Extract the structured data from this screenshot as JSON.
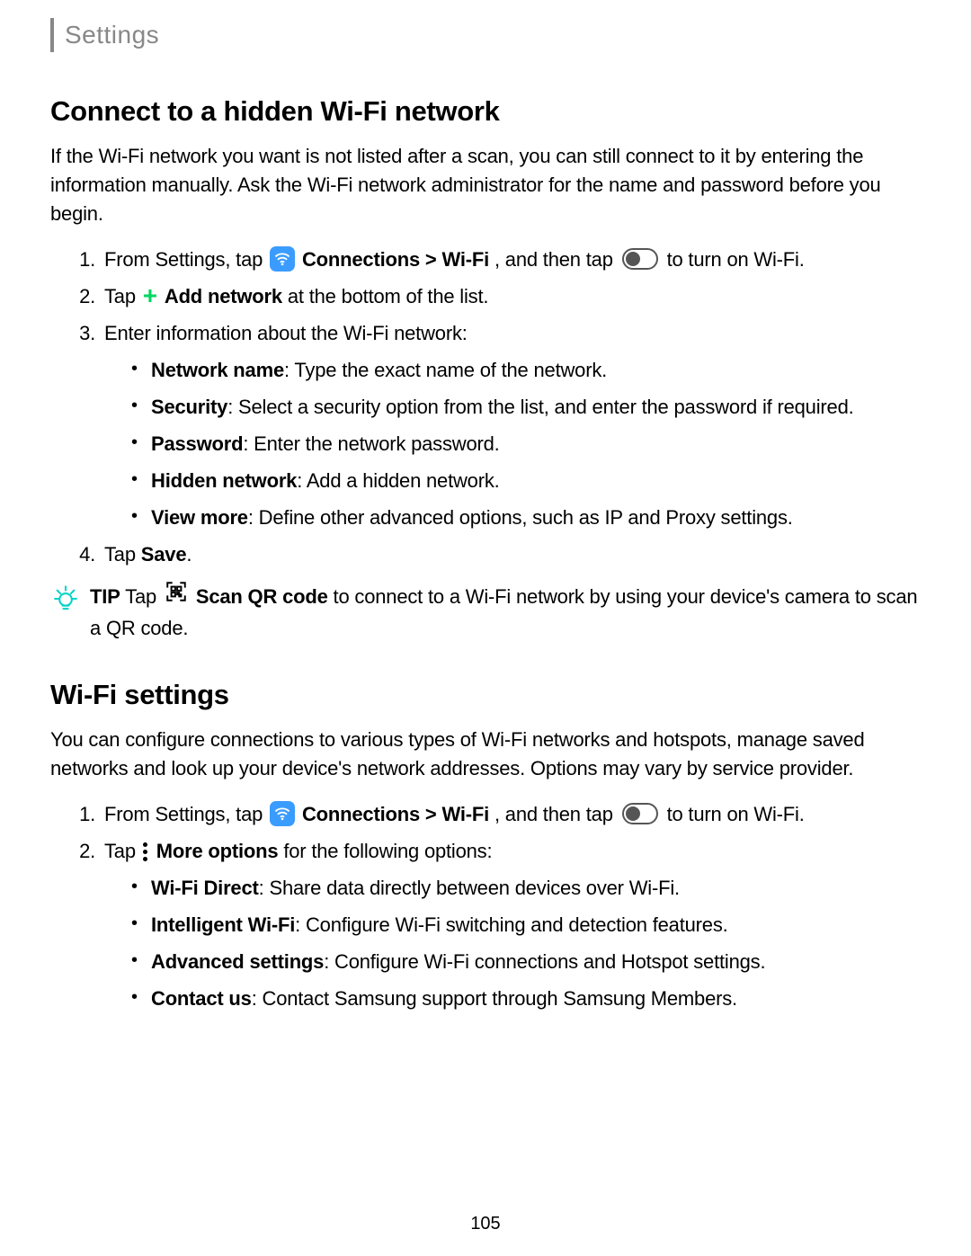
{
  "header": {
    "title": "Settings"
  },
  "section1": {
    "heading": "Connect to a hidden Wi-Fi network",
    "intro": "If the Wi-Fi network you want is not listed after a scan, you can still connect to it by entering the information manually. Ask the Wi-Fi network administrator for the name and password before you begin.",
    "steps": {
      "s1_pre": "From Settings, tap ",
      "s1_conn": "Connections > Wi-Fi",
      "s1_mid": ", and then tap ",
      "s1_post": " to turn on Wi-Fi.",
      "s2_pre": "Tap ",
      "s2_add": "Add network",
      "s2_post": " at the bottom of the list.",
      "s3": "Enter information about the Wi-Fi network:",
      "bullets": {
        "b1_label": "Network name",
        "b1_text": ": Type the exact name of the network.",
        "b2_label": "Security",
        "b2_text": ": Select a security option from the list, and enter the password if required.",
        "b3_label": "Password",
        "b3_text": ": Enter the network password.",
        "b4_label": "Hidden network",
        "b4_text": ": Add a hidden network.",
        "b5_label": "View more",
        "b5_text": ": Define other advanced options, such as IP and Proxy settings."
      },
      "s4_pre": "Tap ",
      "s4_save": "Save",
      "s4_post": "."
    },
    "tip": {
      "label": "TIP",
      "pre": "  Tap ",
      "scan": "Scan QR code",
      "post": " to connect to a Wi-Fi network by using your device's camera to scan a QR code."
    }
  },
  "section2": {
    "heading": "Wi-Fi settings",
    "intro": "You can configure connections to various types of Wi-Fi networks and hotspots, manage saved networks and look up your device's network addresses. Options may vary by service provider.",
    "steps": {
      "s1_pre": "From Settings, tap ",
      "s1_conn": "Connections > Wi-Fi",
      "s1_mid": ", and then tap ",
      "s1_post": " to turn on Wi-Fi.",
      "s2_pre": "Tap ",
      "s2_more": "More options",
      "s2_post": " for the following options:",
      "bullets": {
        "b1_label": "Wi-Fi Direct",
        "b1_text": ": Share data directly between devices over Wi-Fi.",
        "b2_label": "Intelligent Wi-Fi",
        "b2_text": ": Configure Wi-Fi switching and detection features.",
        "b3_label": "Advanced settings",
        "b3_text": ": Configure Wi-Fi connections and Hotspot settings.",
        "b4_label": "Contact us",
        "b4_text": ": Contact Samsung support through Samsung Members."
      }
    }
  },
  "page": "105"
}
